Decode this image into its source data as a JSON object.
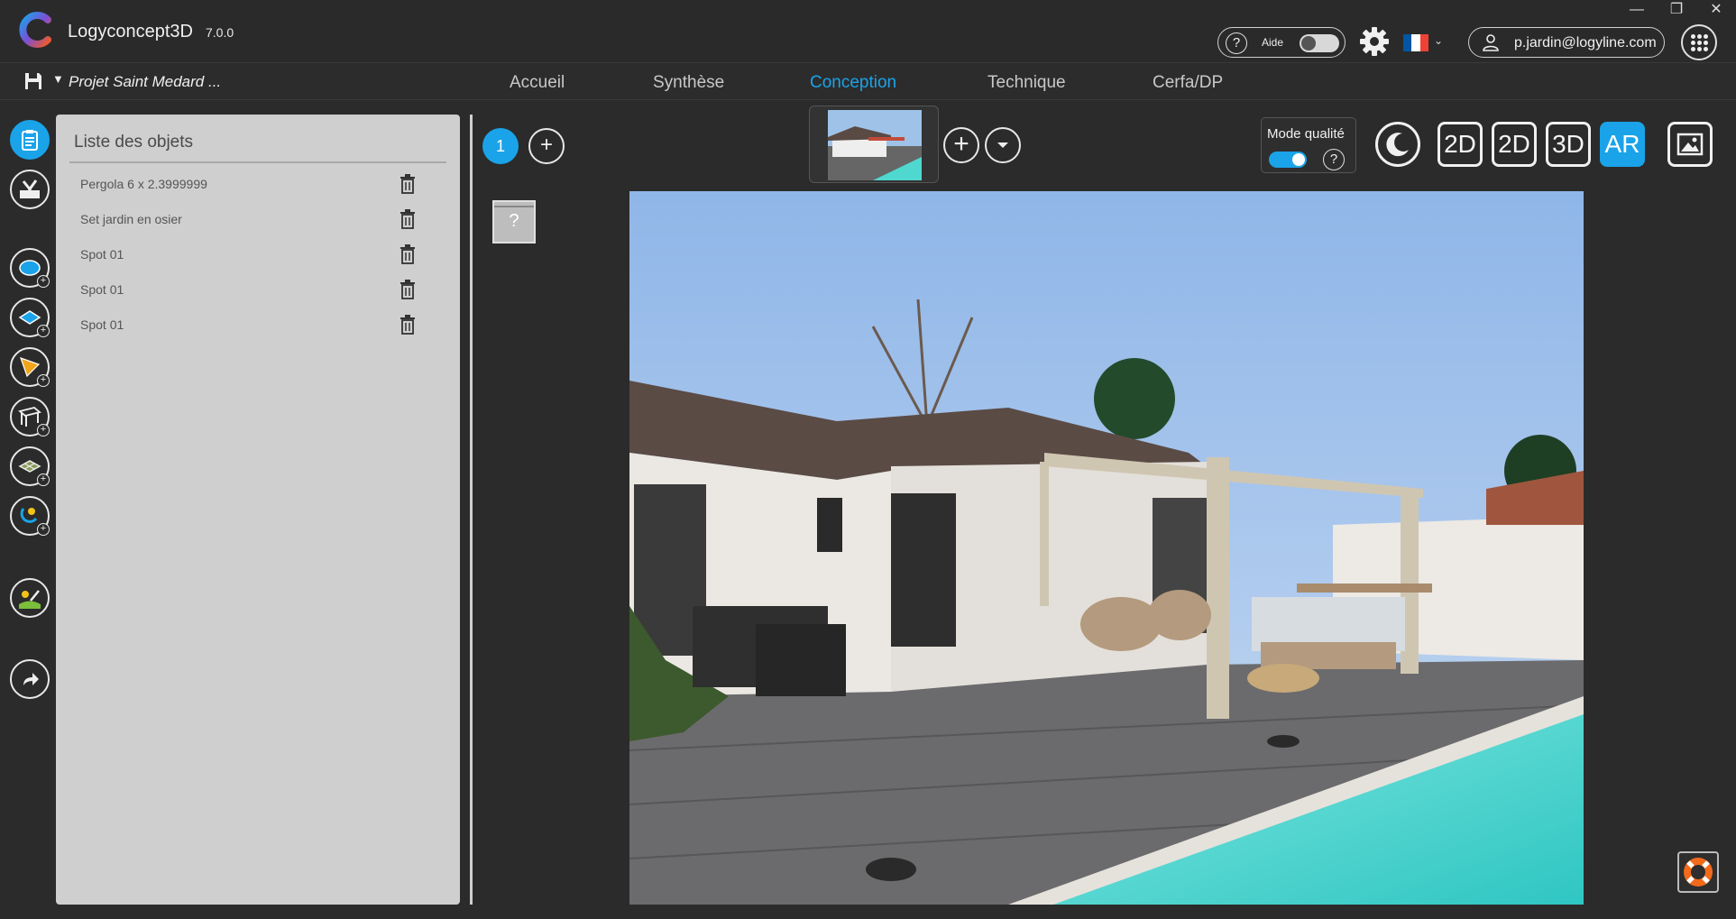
{
  "app": {
    "name": "Logyconcept3D",
    "version": "7.0.0"
  },
  "window_controls": {
    "minimize": "—",
    "maximize": "❐",
    "close": "✕"
  },
  "header": {
    "help_label": "Aide",
    "help_icon": "?",
    "help_enabled": false,
    "language": "fr",
    "flag_colors": [
      "#0055a4",
      "#ffffff",
      "#ef4135"
    ],
    "user_email": "p.jardin@logyline.com"
  },
  "nav": {
    "project_name": "Projet Saint Medard ...",
    "tabs": [
      {
        "label": "Accueil",
        "active": false
      },
      {
        "label": "Synthèse",
        "active": false
      },
      {
        "label": "Conception",
        "active": true
      },
      {
        "label": "Technique",
        "active": false
      },
      {
        "label": "Cerfa/DP",
        "active": false
      }
    ]
  },
  "toolbar": {
    "items": [
      "clipboard-icon",
      "tools-icon",
      "pool-add-icon",
      "terrain-add-icon",
      "sail-add-icon",
      "pergola-add-icon",
      "ground-add-icon",
      "magnet-add-icon",
      "landscape-edit-icon",
      "share-icon"
    ]
  },
  "object_list": {
    "title": "Liste des objets",
    "items": [
      {
        "label": "Pergola 6 x 2.3999999"
      },
      {
        "label": "Set jardin en osier"
      },
      {
        "label": "Spot 01"
      },
      {
        "label": "Spot 01"
      },
      {
        "label": "Spot 01"
      }
    ]
  },
  "view": {
    "page_number": "1",
    "add_page": "+",
    "placeholder_mark": "?",
    "add_view": "+",
    "quality_mode_label": "Mode qualité",
    "quality_mode_enabled": true,
    "quality_help": "?",
    "view_modes": [
      {
        "label": "2D",
        "active": false
      },
      {
        "label": "2D",
        "active": false
      },
      {
        "label": "3D",
        "active": false
      },
      {
        "label": "AR",
        "active": true
      }
    ]
  },
  "colors": {
    "accent": "#1aa3e8",
    "panel": "#cfcfcf",
    "background": "#2b2b2b"
  }
}
